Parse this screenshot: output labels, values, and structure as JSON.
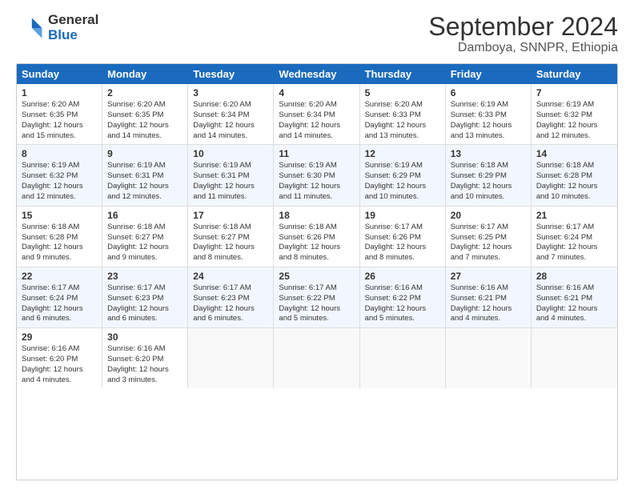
{
  "header": {
    "logo_line1": "General",
    "logo_line2": "Blue",
    "main_title": "September 2024",
    "subtitle": "Damboya, SNNPR, Ethiopia"
  },
  "calendar": {
    "days_of_week": [
      "Sunday",
      "Monday",
      "Tuesday",
      "Wednesday",
      "Thursday",
      "Friday",
      "Saturday"
    ],
    "rows": [
      [
        {
          "day": "1",
          "lines": [
            "Sunrise: 6:20 AM",
            "Sunset: 6:35 PM",
            "Daylight: 12 hours",
            "and 15 minutes."
          ]
        },
        {
          "day": "2",
          "lines": [
            "Sunrise: 6:20 AM",
            "Sunset: 6:35 PM",
            "Daylight: 12 hours",
            "and 14 minutes."
          ]
        },
        {
          "day": "3",
          "lines": [
            "Sunrise: 6:20 AM",
            "Sunset: 6:34 PM",
            "Daylight: 12 hours",
            "and 14 minutes."
          ]
        },
        {
          "day": "4",
          "lines": [
            "Sunrise: 6:20 AM",
            "Sunset: 6:34 PM",
            "Daylight: 12 hours",
            "and 14 minutes."
          ]
        },
        {
          "day": "5",
          "lines": [
            "Sunrise: 6:20 AM",
            "Sunset: 6:33 PM",
            "Daylight: 12 hours",
            "and 13 minutes."
          ]
        },
        {
          "day": "6",
          "lines": [
            "Sunrise: 6:19 AM",
            "Sunset: 6:33 PM",
            "Daylight: 12 hours",
            "and 13 minutes."
          ]
        },
        {
          "day": "7",
          "lines": [
            "Sunrise: 6:19 AM",
            "Sunset: 6:32 PM",
            "Daylight: 12 hours",
            "and 12 minutes."
          ]
        }
      ],
      [
        {
          "day": "8",
          "lines": [
            "Sunrise: 6:19 AM",
            "Sunset: 6:32 PM",
            "Daylight: 12 hours",
            "and 12 minutes."
          ]
        },
        {
          "day": "9",
          "lines": [
            "Sunrise: 6:19 AM",
            "Sunset: 6:31 PM",
            "Daylight: 12 hours",
            "and 12 minutes."
          ]
        },
        {
          "day": "10",
          "lines": [
            "Sunrise: 6:19 AM",
            "Sunset: 6:31 PM",
            "Daylight: 12 hours",
            "and 11 minutes."
          ]
        },
        {
          "day": "11",
          "lines": [
            "Sunrise: 6:19 AM",
            "Sunset: 6:30 PM",
            "Daylight: 12 hours",
            "and 11 minutes."
          ]
        },
        {
          "day": "12",
          "lines": [
            "Sunrise: 6:19 AM",
            "Sunset: 6:29 PM",
            "Daylight: 12 hours",
            "and 10 minutes."
          ]
        },
        {
          "day": "13",
          "lines": [
            "Sunrise: 6:18 AM",
            "Sunset: 6:29 PM",
            "Daylight: 12 hours",
            "and 10 minutes."
          ]
        },
        {
          "day": "14",
          "lines": [
            "Sunrise: 6:18 AM",
            "Sunset: 6:28 PM",
            "Daylight: 12 hours",
            "and 10 minutes."
          ]
        }
      ],
      [
        {
          "day": "15",
          "lines": [
            "Sunrise: 6:18 AM",
            "Sunset: 6:28 PM",
            "Daylight: 12 hours",
            "and 9 minutes."
          ]
        },
        {
          "day": "16",
          "lines": [
            "Sunrise: 6:18 AM",
            "Sunset: 6:27 PM",
            "Daylight: 12 hours",
            "and 9 minutes."
          ]
        },
        {
          "day": "17",
          "lines": [
            "Sunrise: 6:18 AM",
            "Sunset: 6:27 PM",
            "Daylight: 12 hours",
            "and 8 minutes."
          ]
        },
        {
          "day": "18",
          "lines": [
            "Sunrise: 6:18 AM",
            "Sunset: 6:26 PM",
            "Daylight: 12 hours",
            "and 8 minutes."
          ]
        },
        {
          "day": "19",
          "lines": [
            "Sunrise: 6:17 AM",
            "Sunset: 6:26 PM",
            "Daylight: 12 hours",
            "and 8 minutes."
          ]
        },
        {
          "day": "20",
          "lines": [
            "Sunrise: 6:17 AM",
            "Sunset: 6:25 PM",
            "Daylight: 12 hours",
            "and 7 minutes."
          ]
        },
        {
          "day": "21",
          "lines": [
            "Sunrise: 6:17 AM",
            "Sunset: 6:24 PM",
            "Daylight: 12 hours",
            "and 7 minutes."
          ]
        }
      ],
      [
        {
          "day": "22",
          "lines": [
            "Sunrise: 6:17 AM",
            "Sunset: 6:24 PM",
            "Daylight: 12 hours",
            "and 6 minutes."
          ]
        },
        {
          "day": "23",
          "lines": [
            "Sunrise: 6:17 AM",
            "Sunset: 6:23 PM",
            "Daylight: 12 hours",
            "and 6 minutes."
          ]
        },
        {
          "day": "24",
          "lines": [
            "Sunrise: 6:17 AM",
            "Sunset: 6:23 PM",
            "Daylight: 12 hours",
            "and 6 minutes."
          ]
        },
        {
          "day": "25",
          "lines": [
            "Sunrise: 6:17 AM",
            "Sunset: 6:22 PM",
            "Daylight: 12 hours",
            "and 5 minutes."
          ]
        },
        {
          "day": "26",
          "lines": [
            "Sunrise: 6:16 AM",
            "Sunset: 6:22 PM",
            "Daylight: 12 hours",
            "and 5 minutes."
          ]
        },
        {
          "day": "27",
          "lines": [
            "Sunrise: 6:16 AM",
            "Sunset: 6:21 PM",
            "Daylight: 12 hours",
            "and 4 minutes."
          ]
        },
        {
          "day": "28",
          "lines": [
            "Sunrise: 6:16 AM",
            "Sunset: 6:21 PM",
            "Daylight: 12 hours",
            "and 4 minutes."
          ]
        }
      ],
      [
        {
          "day": "29",
          "lines": [
            "Sunrise: 6:16 AM",
            "Sunset: 6:20 PM",
            "Daylight: 12 hours",
            "and 4 minutes."
          ]
        },
        {
          "day": "30",
          "lines": [
            "Sunrise: 6:16 AM",
            "Sunset: 6:20 PM",
            "Daylight: 12 hours",
            "and 3 minutes."
          ]
        },
        {
          "day": "",
          "lines": []
        },
        {
          "day": "",
          "lines": []
        },
        {
          "day": "",
          "lines": []
        },
        {
          "day": "",
          "lines": []
        },
        {
          "day": "",
          "lines": []
        }
      ]
    ]
  }
}
